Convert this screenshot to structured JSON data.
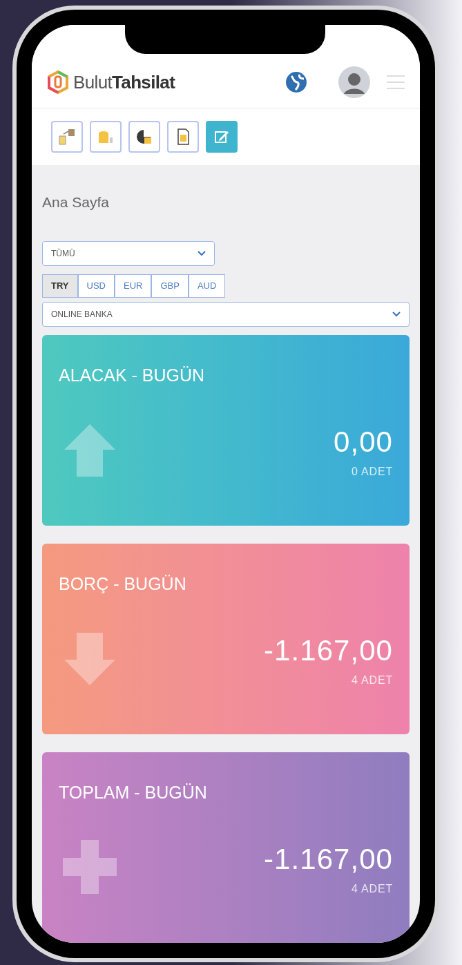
{
  "header": {
    "logo_plain": "Bulut",
    "logo_bold": "Tahsilat"
  },
  "toolbar": [
    {
      "kind": "transfer",
      "selected": false
    },
    {
      "kind": "coins",
      "selected": false
    },
    {
      "kind": "chart",
      "selected": false
    },
    {
      "kind": "document",
      "selected": false
    },
    {
      "kind": "edit",
      "selected": true
    }
  ],
  "page_title": "Ana Sayfa",
  "filter": {
    "value": "TÜMÜ"
  },
  "currency_tabs": [
    {
      "label": "TRY",
      "selected": true
    },
    {
      "label": "USD",
      "selected": false
    },
    {
      "label": "EUR",
      "selected": false
    },
    {
      "label": "GBP",
      "selected": false
    },
    {
      "label": "AUD",
      "selected": false
    }
  ],
  "account": {
    "value": "ONLINE BANKA"
  },
  "cards": [
    {
      "kind": "up",
      "title": "ALACAK - BUGÜN",
      "amount": "0,00",
      "count": "0 ADET"
    },
    {
      "kind": "down",
      "title": "BORÇ - BUGÜN",
      "amount": "-1.167,00",
      "count": "4 ADET"
    },
    {
      "kind": "plus",
      "title": "TOPLAM - BUGÜN",
      "amount": "-1.167,00",
      "count": "4 ADET"
    }
  ]
}
